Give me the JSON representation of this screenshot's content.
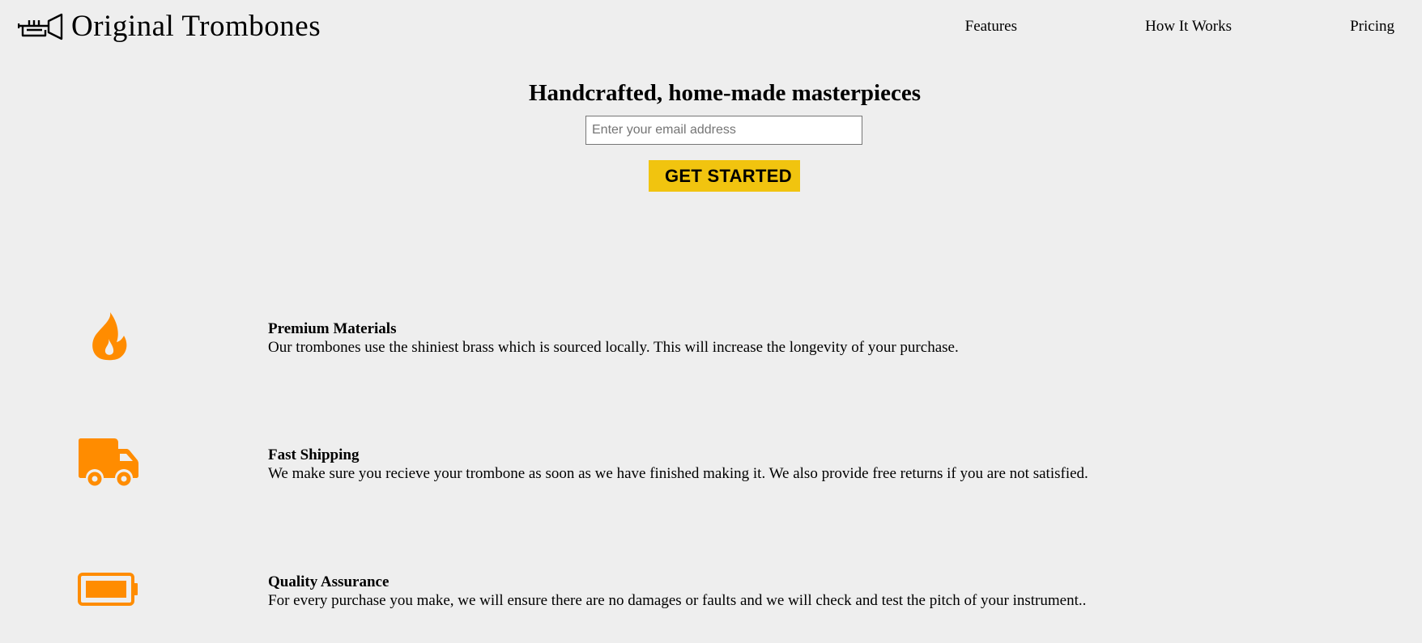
{
  "header": {
    "brand": "Original Trombones",
    "logo_icon": "trombone-icon",
    "nav": [
      {
        "label": "Features"
      },
      {
        "label": "How It Works"
      },
      {
        "label": "Pricing"
      }
    ]
  },
  "hero": {
    "title": "Handcrafted, home-made masterpieces",
    "email_placeholder": "Enter your email address",
    "email_value": "",
    "cta_label": "GET STARTED"
  },
  "features": [
    {
      "icon": "fire-icon",
      "title": "Premium Materials",
      "description": "Our trombones use the shiniest brass which is sourced locally. This will increase the longevity of your purchase."
    },
    {
      "icon": "truck-icon",
      "title": "Fast Shipping",
      "description": "We make sure you recieve your trombone as soon as we have finished making it. We also provide free returns if you are not satisfied."
    },
    {
      "icon": "battery-icon",
      "title": "Quality Assurance",
      "description": "For every purchase you make, we will ensure there are no damages or faults and we will check and test the pitch of your instrument.."
    }
  ],
  "colors": {
    "background": "#eeeeee",
    "accent_button": "#f1c40f",
    "icon_orange": "#ff8c00"
  }
}
